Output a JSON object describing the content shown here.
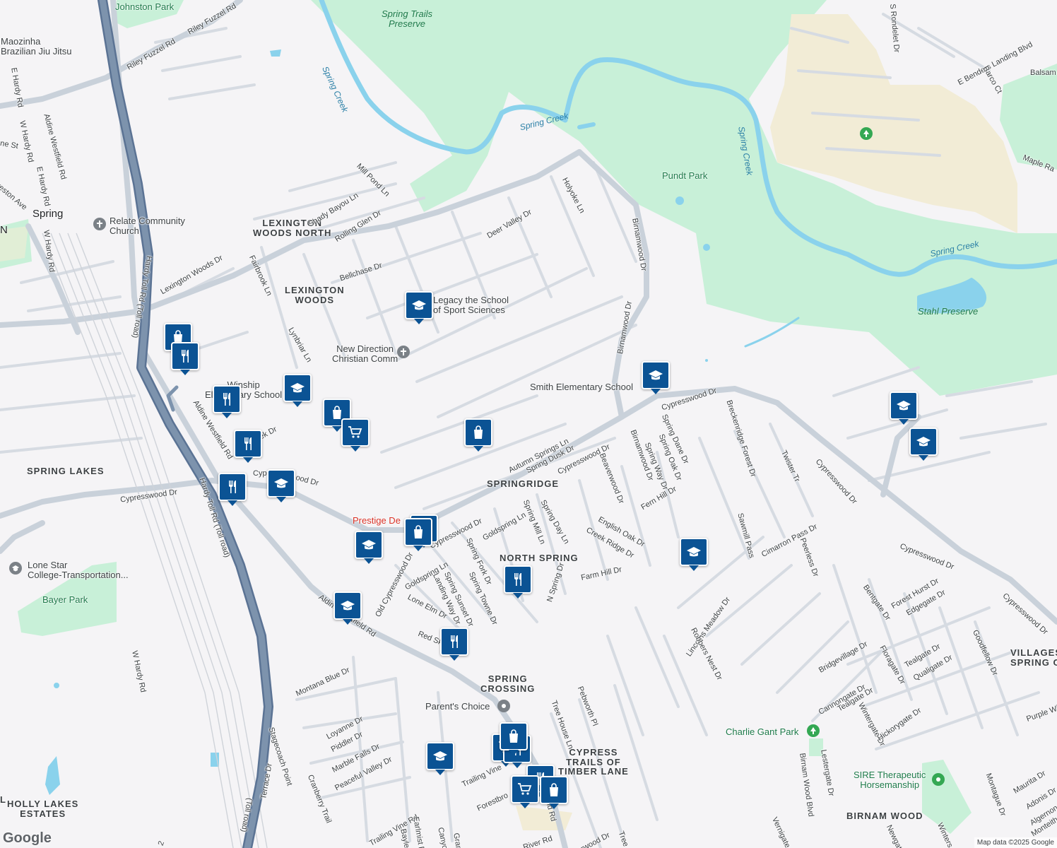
{
  "map": {
    "attribution": "Map data ©2025 Google",
    "logo": "Google",
    "colors": {
      "background": "#f5f4f6",
      "park": "#c8f0d8",
      "water": "#8ad2ec",
      "highway": "#7d93ad",
      "marker": "#0b5394",
      "sand": "#f2ecd6"
    }
  },
  "areas": {
    "lexington_woods_north": "LEXINGTON\nWOODS NORTH",
    "lexington_woods": "LEXINGTON\nWOODS",
    "springridge": "SPRINGRIDGE",
    "north_spring": "NORTH SPRING",
    "spring_lakes": "SPRING LAKES",
    "spring_crossing": "SPRING\nCROSSING",
    "cypress_trails": "CYPRESS\nTRAILS OF\nTIMBER LANE",
    "holly_lakes": "HOLLY LAKES\nESTATES",
    "birnam_wood": "BIRNAM WOOD",
    "villages": "VILLAGES\nSPRING O"
  },
  "places": {
    "spring": "Spring",
    "spring_trails_preserve": "Spring Trails\nPreserve",
    "pundt_park": "Pundt Park",
    "stahl_preserve": "Stahl Preserve",
    "johnston_park": "Johnston Park",
    "maozinha": "Maozinha\nBrazilian Jiu Jitsu",
    "relate": "Relate Community\nChurch",
    "legacy": "Legacy the School\nof Sport Sciences",
    "new_direction": "New Direction\nChristian Comm",
    "smith_elementary": "Smith Elementary School",
    "winship": "Winship\nElementary School",
    "prestige": "Prestige De",
    "lone_star": "Lone Star\nCollege-Transportation...",
    "bayer_park": "Bayer Park",
    "parents_choice": "Parent's Choice",
    "charlie_gant": "Charlie Gant Park",
    "sire": "SIRE Therapeutic\nHorsemanship"
  },
  "water_labels": {
    "spring_creek_1": "Spring Creek",
    "spring_creek_2": "Spring Creek",
    "spring_creek_3": "Spring Creek",
    "spring_creek_4": "Spring Creek"
  },
  "streets": {
    "riley_fuzzel_1": "Riley Fuzzel Rd",
    "riley_fuzzel_2": "Riley Fuzzel Rd",
    "e_hardy": "E Hardy Rd",
    "w_hardy_1": "W Hardy Rd",
    "w_hardy_2": "W Hardy Rd",
    "aldine_westfield_1": "Aldine Westfield Rd",
    "aldine_westfield_2": "Aldine Westfield Rd",
    "aldine_westfield_3": "Aldine Westfield Rd",
    "hardy_toll_1": "Hardy Toll Rd (Toll road)",
    "hardy_toll_2": "Hardy Toll Rd (Toll road)",
    "hardy_toll_3": "(Toll road)",
    "mill_pond": "Mill Pond Ln",
    "shady_bayou": "Shady Bayou Ln",
    "rolling_glen": "Rolling Glen Dr",
    "lexington_woods_dr": "Lexington Woods Dr",
    "fairbrook": "Fairbrook Ln",
    "bellchase": "Bellchase Dr",
    "lynbriar": "Lynbriar Ln",
    "deer_valley": "Deer Valley Dr",
    "holyoke": "Holyoke Ln",
    "birnamwood_1": "Birnamwood Dr",
    "birnamwood_2": "Birnamwood Dr",
    "birnamwood_3": "Birnamwood Dr",
    "cypresswood_1": "Cypresswood Dr",
    "cypresswood_2": "Cypresswood Dr",
    "cypresswood_3": "Cypresswood Dr",
    "cypresswood_4": "Cypresswood Dr",
    "cypresswood_5": "Cypresswood Dr",
    "cypresswood_6": "Cypresswood Dr",
    "cypresswood_7": "Cypresswood Dr",
    "autumn_springs": "Autumn Springs Ln",
    "spring_dusk": "Spring Dusk Dr",
    "beaverwood": "Beaverwood Dr",
    "spring_way": "Spring Way Dr",
    "spring_dane": "Spring Dane Dr",
    "spring_oak": "Spring Oak Dr",
    "breckenridge": "Breckenridge Forest Dr",
    "twister": "Twister Tr",
    "fern_hill": "Fern Hill Dr",
    "english_oak": "English Oak Dr",
    "creek_ridge": "Creek Ridge Dr",
    "farm_hill": "Farm Hill Dr",
    "spring_mill": "Spring Mill Ln",
    "spring_day": "Spring Day Ln",
    "n_spring": "N Spring Dr",
    "goldspring_1": "Goldspring Ln",
    "goldspring_2": "Goldspring Ln",
    "spring_fork": "Spring Fork Dr",
    "spring_towne": "Spring Towne Dr",
    "spring_sunset": "Spring Sunset Dr",
    "landing_way": "Landing Way Dr",
    "lone_elm": "Lone Elm Dr",
    "old_cypresswood": "Old Cypresswood Dr",
    "red_sky": "Red Sk",
    "sawmill": "Sawmill Pass",
    "cimarron": "Cimarron Pass Dr",
    "peerless": "Peerless Dr",
    "lincolns_meadow": "Lincolns Meadow Dr",
    "robbers_nest": "Robbers Nest Dr",
    "bentgate": "Bentgate Dr",
    "forest_hurst": "Forest Hurst Dr",
    "edgegate": "Edgegate Dr",
    "goodfellow": "Goodfellow Dr",
    "bridgevillage": "Bridgevillage Dr",
    "floragate": "Floragate Dr",
    "tealgate_1": "Tealgate Dr",
    "tealgate_2": "Tealgate Dr",
    "qualigate": "Qualigate Dr",
    "cannongate": "Cannongate Dr",
    "wintergate": "Wintergate Dr",
    "hickorygate": "Hickorygate Dr",
    "lestergate": "Lestergate Dr",
    "birnam_wood_blvd": "Birnam Wood Blvd",
    "montana_blue": "Montana Blue Dr",
    "stagecoach": "Stagecoach Point",
    "loyanne": "Loyanne Dr",
    "piddler": "Piddler Dr",
    "marble_falls": "Marble Falls Dr",
    "peaceful_valley": "Peaceful Valley Dr",
    "cranberry": "Cranberry Trail",
    "trailing_vine_1": "Trailing Vine",
    "trailing_vine_2": "Trailing Vine Rd",
    "earlmist": "Earlmist P",
    "bayles": "Bayles",
    "canyo": "Canyo",
    "forestbro": "Forestbro",
    "tree_house": "Tree House Ln",
    "pebworth": "Pebworth Pl",
    "river_rd": "River Rd",
    "tree": "Tree",
    "erwood": "erwood Dr",
    "montague": "Montague Dr",
    "maurita": "Maurita Dr",
    "adonis": "Adonis Dr",
    "algernon": "Algernon Dr",
    "monteith": "Monteith",
    "purple": "Purple Wi",
    "e_benders": "E Benders Landing Blvd",
    "s_rondelet": "S Rondelet Dr",
    "barco": "Barco Ct",
    "balsam": "Balsam",
    "maple": "Maple Ra",
    "vernigate": "Vernigate",
    "newgat": "Newgat",
    "winters": "Winters",
    "terrace": "Terrace Dr",
    "gran": "Gran",
    "eld": "eld Rd",
    "n_st": "ne St",
    "reston": "reston Ave",
    "hardy_top": "Hardy Rd",
    "creek_dr": "Creek Dr",
    "cyp": "Cyp",
    "ood": "ood Dr",
    "two": "2",
    "n": "N",
    "l": "L"
  },
  "markers": [
    {
      "name": "shopping-marker",
      "icon": "bag"
    },
    {
      "name": "restaurant-marker",
      "icon": "fork-knife"
    },
    {
      "name": "restaurant-marker",
      "icon": "fork-knife"
    },
    {
      "name": "school-marker",
      "icon": "cap"
    },
    {
      "name": "shopping-marker",
      "icon": "bag"
    },
    {
      "name": "grocery-marker",
      "icon": "cart"
    },
    {
      "name": "restaurant-marker",
      "icon": "fork-knife"
    },
    {
      "name": "shopping-marker",
      "icon": "bag"
    },
    {
      "name": "school-marker",
      "icon": "cap"
    },
    {
      "name": "restaurant-marker",
      "icon": "fork-knife"
    },
    {
      "name": "school-marker",
      "icon": "cap"
    },
    {
      "name": "shopping-marker",
      "icon": "bag"
    },
    {
      "name": "school-marker",
      "icon": "cap"
    },
    {
      "name": "shopping-marker",
      "icon": "bag"
    },
    {
      "name": "restaurant-marker",
      "icon": "fork-knife"
    },
    {
      "name": "restaurant-marker",
      "icon": "fork-knife"
    },
    {
      "name": "school-marker",
      "icon": "cap"
    },
    {
      "name": "school-marker",
      "icon": "cap"
    },
    {
      "name": "school-marker",
      "icon": "cap"
    },
    {
      "name": "school-marker",
      "icon": "cap"
    },
    {
      "name": "school-marker",
      "icon": "cap"
    },
    {
      "name": "grocery-marker",
      "icon": "cart"
    },
    {
      "name": "restaurant-marker",
      "icon": "fork-knife"
    },
    {
      "name": "shopping-marker",
      "icon": "bag"
    },
    {
      "name": "restaurant-marker",
      "icon": "fork-knife"
    },
    {
      "name": "grocery-marker",
      "icon": "cart"
    },
    {
      "name": "shopping-marker",
      "icon": "bag"
    },
    {
      "name": "school-marker",
      "icon": "cap"
    }
  ]
}
